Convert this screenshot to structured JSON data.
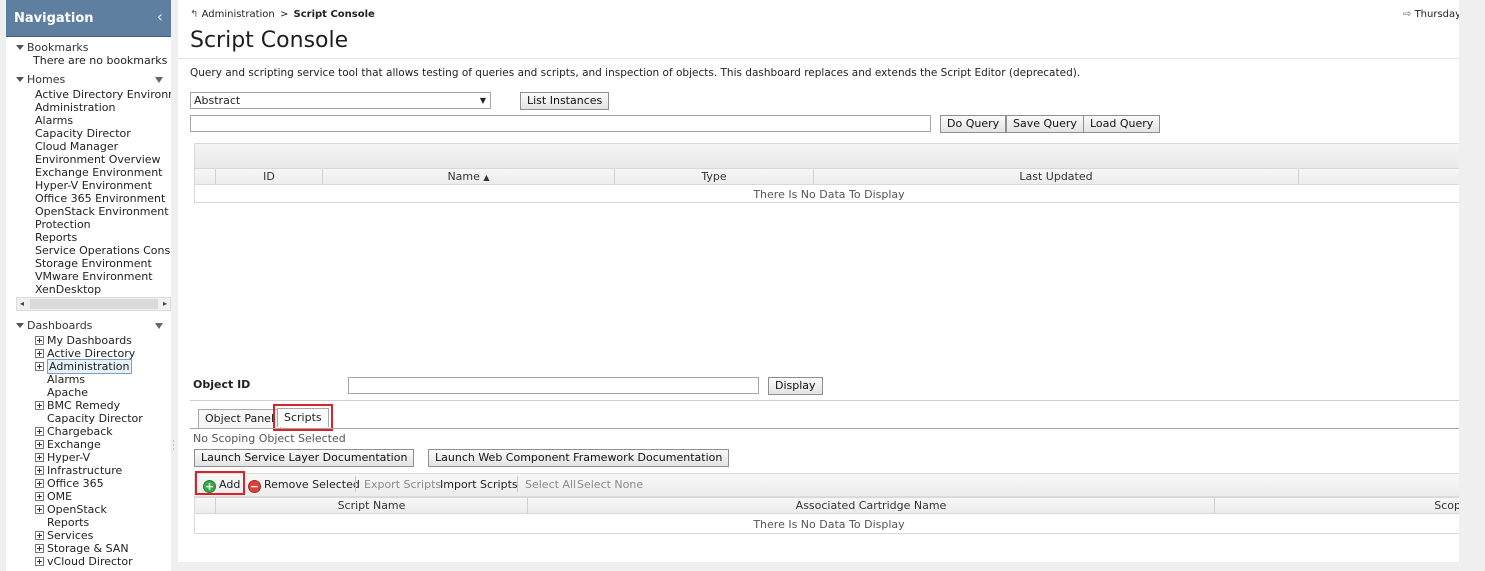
{
  "sidebar": {
    "title": "Navigation",
    "collapse_icon": "chevron-left-icon",
    "bookmarks": {
      "label": "Bookmarks",
      "empty_text": "There are no bookmarks"
    },
    "homes": {
      "label": "Homes",
      "items": [
        "Active Directory Environment",
        "Administration",
        "Alarms",
        "Capacity Director",
        "Cloud Manager",
        "Environment Overview",
        "Exchange Environment",
        "Hyper-V Environment",
        "Office 365 Environment",
        "OpenStack Environment",
        "Protection",
        "Reports",
        "Service Operations Console",
        "Storage Environment",
        "VMware Environment",
        "XenDesktop"
      ]
    },
    "dashboards": {
      "label": "Dashboards",
      "items": [
        {
          "label": "My Dashboards",
          "expandable": true
        },
        {
          "label": "Active Directory",
          "expandable": true
        },
        {
          "label": "Administration",
          "expandable": true,
          "selected": true
        },
        {
          "label": "Alarms",
          "expandable": false
        },
        {
          "label": "Apache",
          "expandable": false
        },
        {
          "label": "BMC Remedy",
          "expandable": true
        },
        {
          "label": "Capacity Director",
          "expandable": false
        },
        {
          "label": "Chargeback",
          "expandable": true
        },
        {
          "label": "Exchange",
          "expandable": true
        },
        {
          "label": "Hyper-V",
          "expandable": true
        },
        {
          "label": "Infrastructure",
          "expandable": true
        },
        {
          "label": "Office 365",
          "expandable": true
        },
        {
          "label": "OME",
          "expandable": true
        },
        {
          "label": "OpenStack",
          "expandable": true
        },
        {
          "label": "Reports",
          "expandable": false
        },
        {
          "label": "Services",
          "expandable": true
        },
        {
          "label": "Storage & SAN",
          "expandable": true
        },
        {
          "label": "vCloud Director",
          "expandable": true
        }
      ]
    }
  },
  "header": {
    "breadcrumb_root": "Administration",
    "breadcrumb_sep": ">",
    "breadcrumb_current": "Script Console",
    "date_text": "Thursday,",
    "title": "Script Console",
    "description": "Query and scripting service tool that allows testing of queries and scripts, and inspection of objects. This dashboard replaces and extends the Script Editor (deprecated)."
  },
  "query": {
    "type_selected": "Abstract",
    "list_instances_label": "List Instances",
    "query_value": "",
    "do_query_label": "Do Query",
    "save_query_label": "Save Query",
    "load_query_label": "Load Query"
  },
  "results_table": {
    "columns": [
      "ID",
      "Name",
      "Type",
      "Last Updated"
    ],
    "sort_indicator": "▲",
    "empty_text": "There Is No Data To Display"
  },
  "object": {
    "label": "Object ID",
    "value": "",
    "display_label": "Display"
  },
  "tabs": [
    "Object Panel",
    "Scripts"
  ],
  "scripts": {
    "scope_text": "No Scoping Object Selected",
    "launch_service_doc": "Launch Service Layer Documentation",
    "launch_wcf_doc": "Launch Web Component Framework Documentation",
    "toolbar": {
      "add": "Add",
      "remove_selected": "Remove Selected",
      "export_scripts": "Export Scripts",
      "import_scripts": "Import Scripts",
      "select_all": "Select All",
      "select_none": "Select None"
    },
    "columns": [
      "Script Name",
      "Associated Cartridge Name",
      "Scop"
    ],
    "empty_text": "There Is No Data To Display"
  },
  "colors": {
    "nav_header": "#5f7fa1",
    "highlight_box": "#d9232a",
    "add_icon": "#3aa84a",
    "remove_icon": "#e0403a"
  }
}
